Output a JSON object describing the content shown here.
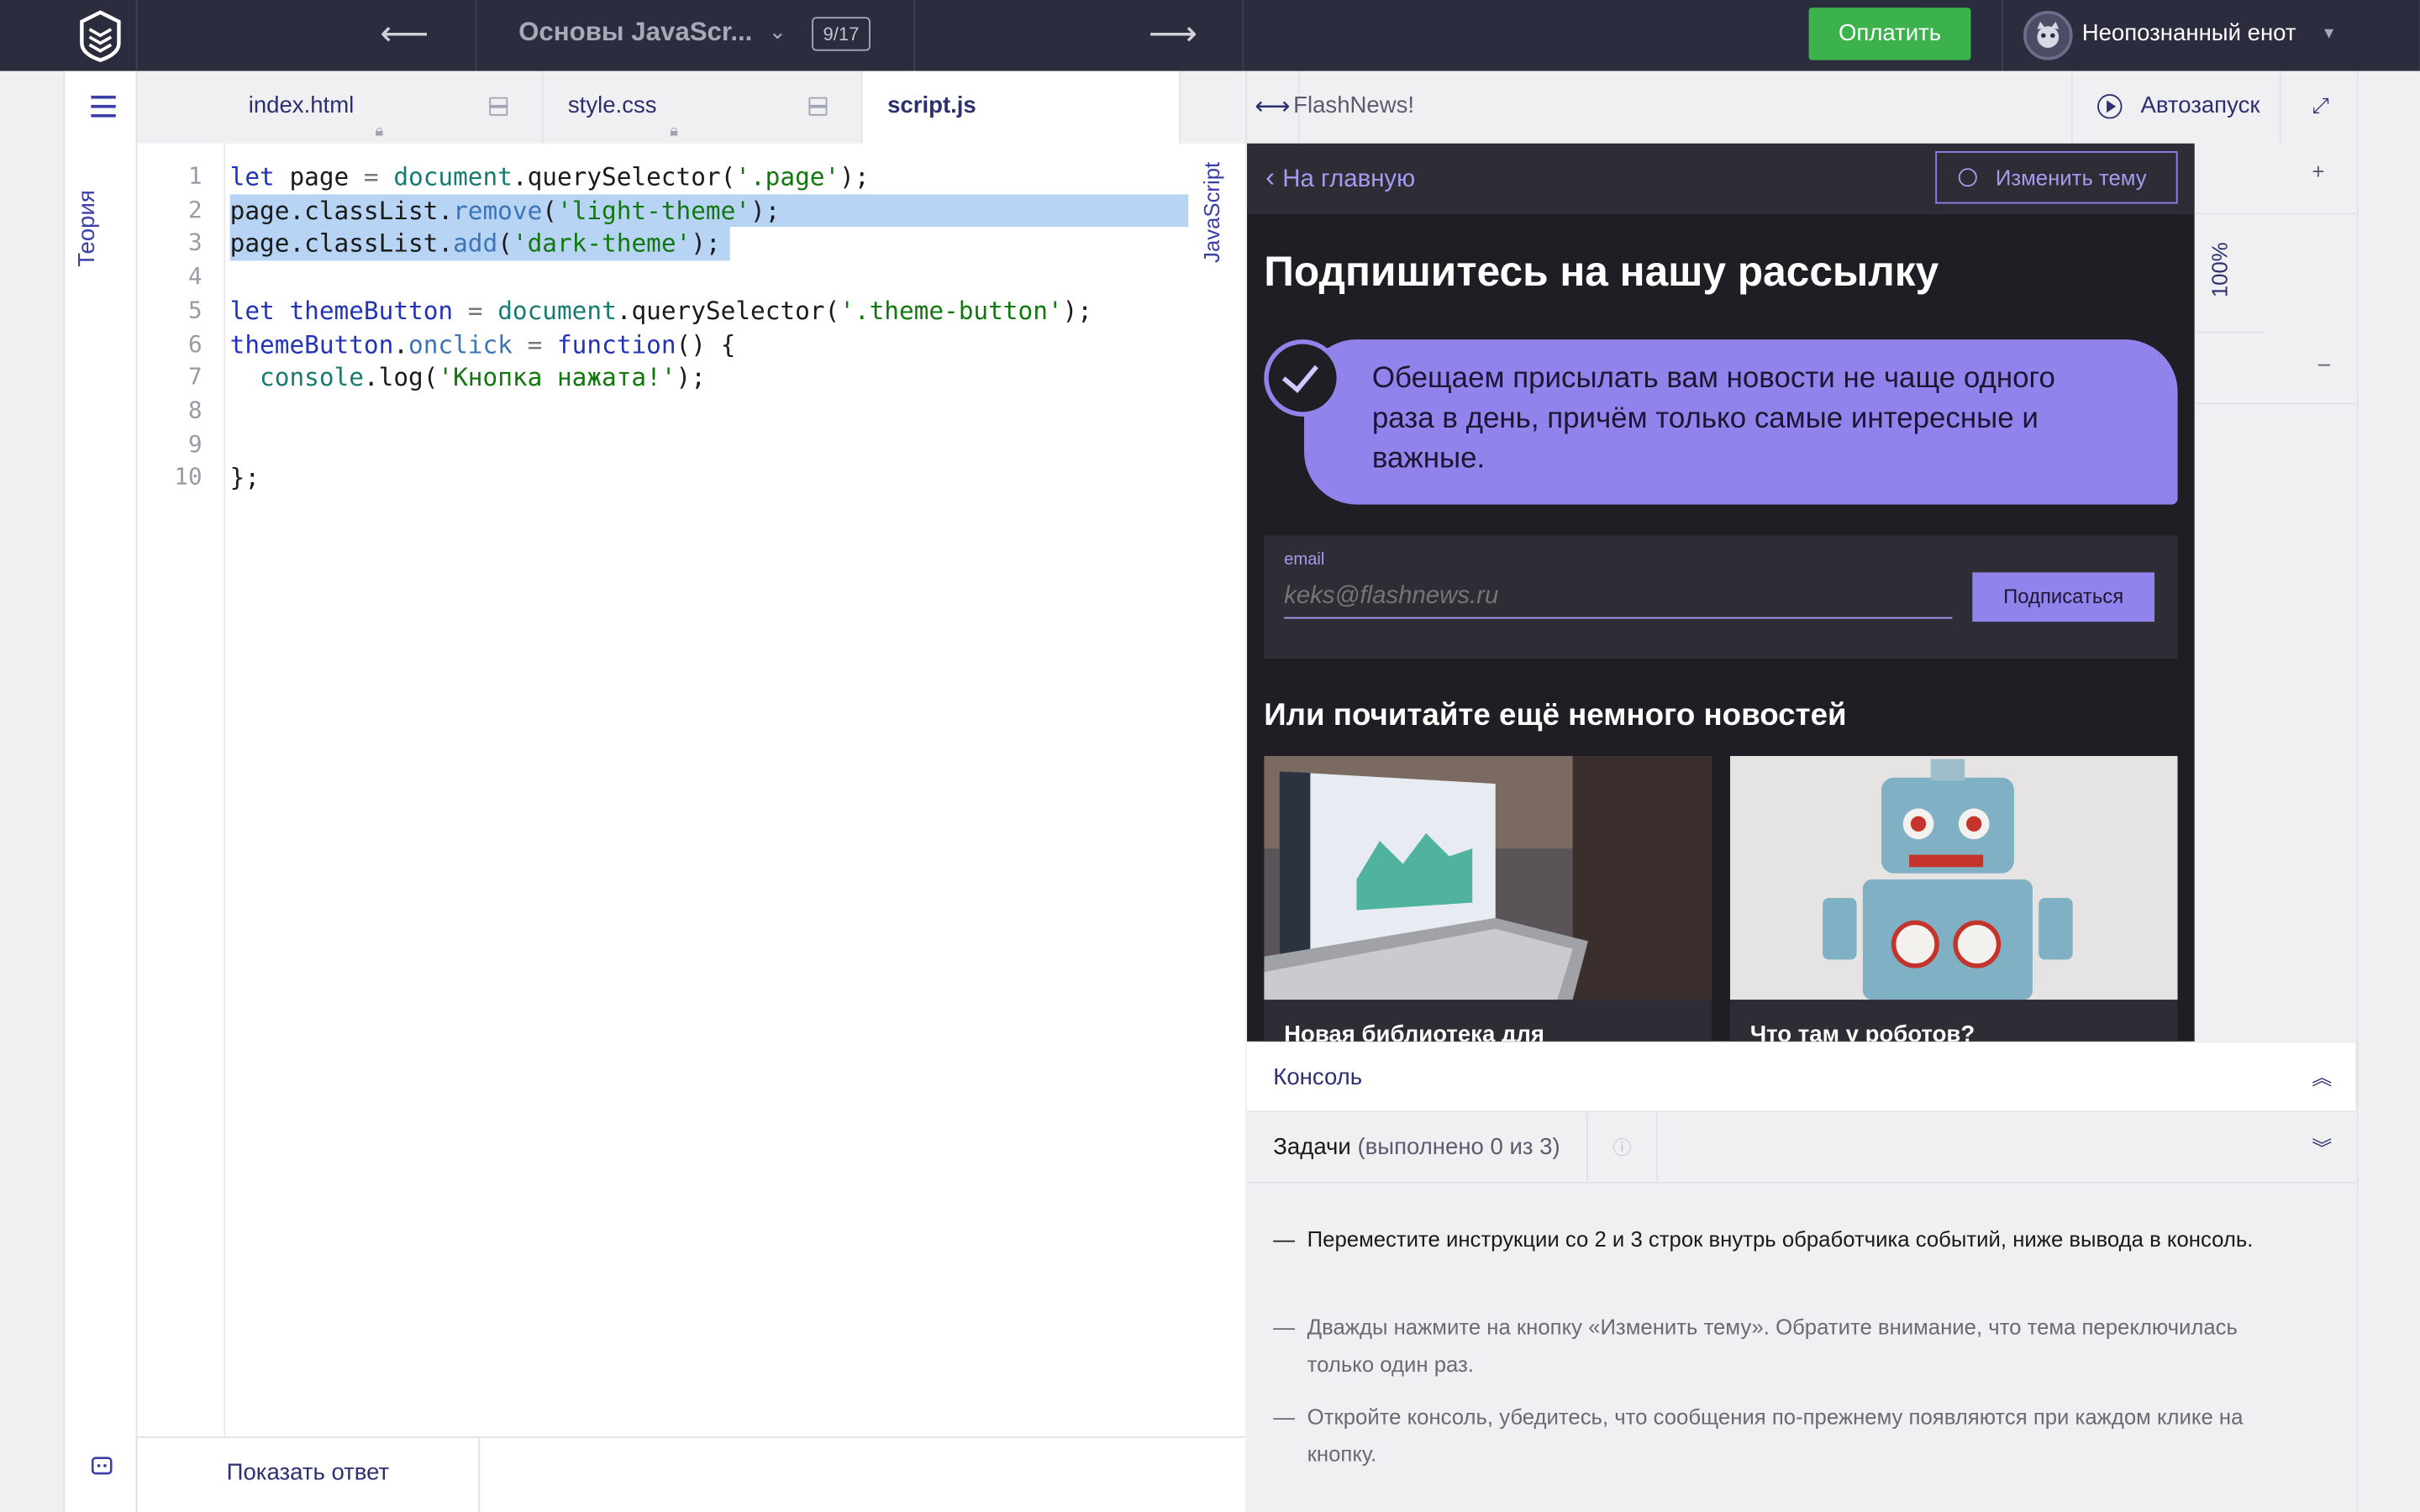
{
  "topbar": {
    "course_title": "Основы JavaScr...",
    "progress": "9/17",
    "pay_label": "Оплатить",
    "username": "Неопознанный енот",
    "prev_arrow": "⟵",
    "next_arrow": "⟶",
    "caret": "▾"
  },
  "rail": {
    "theory_label": "Теория"
  },
  "tabs": [
    {
      "label": "index.html",
      "locked": true
    },
    {
      "label": "style.css",
      "locked": true
    },
    {
      "label": "script.js",
      "active": true
    }
  ],
  "editor": {
    "language": "JavaScript",
    "line_numbers": [
      "1",
      "2",
      "3",
      "4",
      "5",
      "6",
      "7",
      "8",
      "9",
      "10"
    ],
    "lines": [
      "let page = document.querySelector('.page');",
      "page.classList.remove('light-theme');",
      "page.classList.add('dark-theme');",
      "",
      "let themeButton = document.querySelector('.theme-button');",
      "themeButton.onclick = function() {",
      "  console.log('Кнопка нажата!');",
      "",
      "",
      "};"
    ],
    "highlighted_lines": [
      2,
      3
    ]
  },
  "bottombar": {
    "show_answer": "Показать ответ"
  },
  "preview": {
    "site_name": "FlashNews!",
    "autorun": "Автозапуск",
    "zoom": "100%",
    "zoom_plus": "+",
    "zoom_minus": "–"
  },
  "site": {
    "back": "На главную",
    "theme_button": "Изменить тему",
    "promo_title": "Подпишитесь на нашу рассылку",
    "bubble_text": "Обещаем присылать вам новости не чаще одного раза в день, причём только самые интересные и важные.",
    "email_label": "email",
    "email_placeholder": "keks@flashnews.ru",
    "subscribe": "Подписаться",
    "more_title": "Или почитайте ещё немного новостей",
    "cards": [
      {
        "title": "Новая библиотека для"
      },
      {
        "title": "Что там у роботов?"
      }
    ]
  },
  "console": {
    "label": "Консоль",
    "toggle": "⌃"
  },
  "tasks": {
    "label": "Задачи",
    "count": "(выполнено 0 из 3)",
    "info": "ⓘ",
    "toggle": "⌄",
    "items": [
      "Переместите инструкции со 2 и 3 строк внутрь обработчика событий, ниже вывода в консоль.",
      "Дважды нажмите на кнопку «Изменить тему». Обратите внимание, что тема переключилась только один раз.",
      "Откройте консоль, убедитесь, что сообщения по-прежнему появляются при каждом клике на кнопку."
    ]
  },
  "colors": {
    "topbar": "#2b2d3e",
    "accent": "#3a3fa8",
    "pay": "#3bb24c",
    "site_accent": "#9084ec",
    "site_bg": "#1f1e24",
    "highlight": "#b8d4f5"
  }
}
